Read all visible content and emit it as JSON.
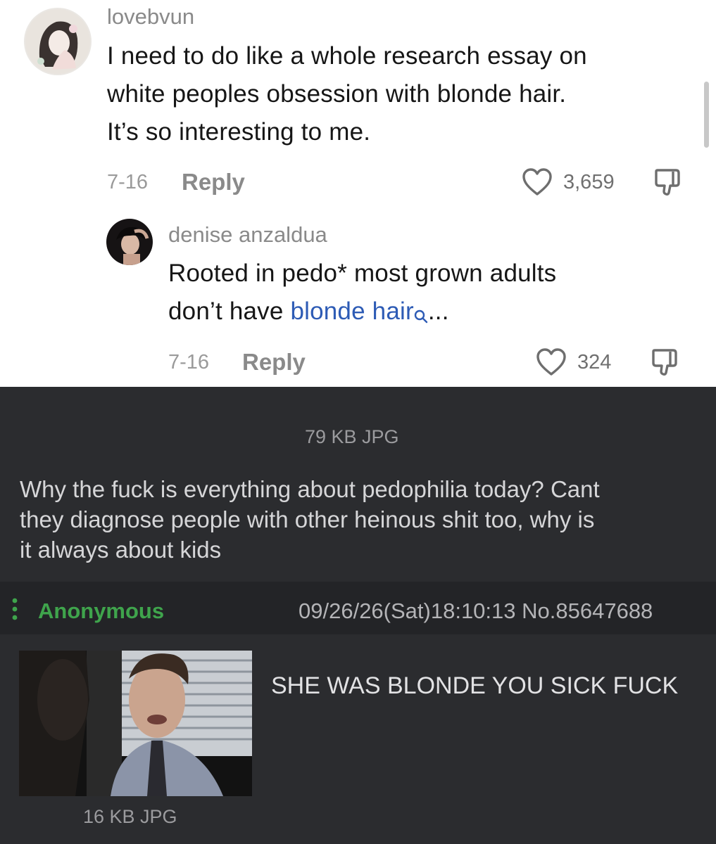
{
  "comments": [
    {
      "username": "lovebvun",
      "text_lines": [
        "I need to do like a whole research essay on",
        "white peoples obsession with blonde hair.",
        "It’s so interesting to me."
      ],
      "date": "7-16",
      "reply_label": "Reply",
      "likes": "3,659"
    },
    {
      "username": "denise anzaldua",
      "line1": "Rooted in pedo* most grown adults",
      "line2_prefix": "don’t have ",
      "line2_link": "blonde hair",
      "line2_suffix": "...",
      "date": "7-16",
      "reply_label": "Reply",
      "likes": "324"
    }
  ],
  "icons": {
    "like": "heart-outline-icon",
    "dislike": "thumbs-down-icon",
    "search": "search-icon",
    "menu": "vertical-dots-icon"
  },
  "colors": {
    "link": "#2d5bb5",
    "anonymous_name": "#3fa44c",
    "dark_bg": "#2b2c2f"
  },
  "chan": {
    "op_file_info": "79 KB JPG",
    "op_text_lines": [
      "Why the fuck is everything about pedophilia today? Cant",
      "they diagnose people with other heinous shit too, why is",
      "it always about kids"
    ],
    "reply": {
      "name": "Anonymous",
      "meta": "09/26/26(Sat)18:10:13 No.85647688",
      "text": "SHE WAS BLONDE YOU SICK FUCK",
      "file_info": "16 KB JPG"
    }
  }
}
